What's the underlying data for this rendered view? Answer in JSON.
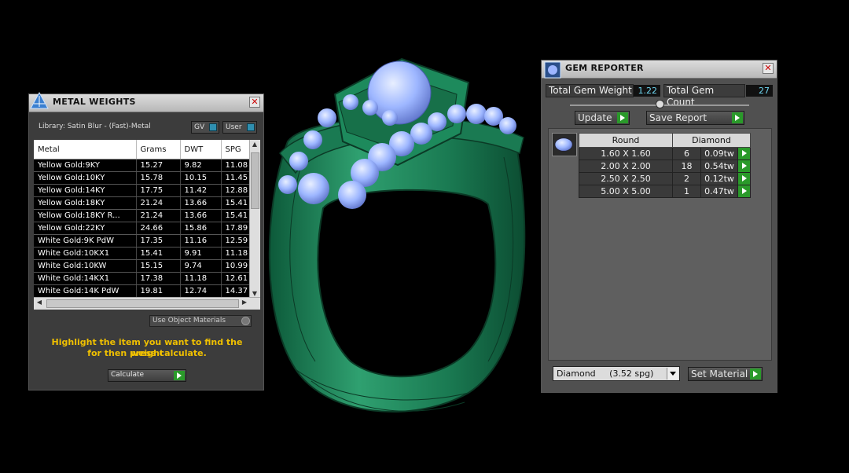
{
  "metal_weights": {
    "title": "METAL WEIGHTS",
    "library_label": "Library: Satin Blur - (Fast)-Metal",
    "toggle_gv": "GV",
    "toggle_user": "User",
    "columns": [
      "Metal",
      "Grams",
      "DWT",
      "SPG"
    ],
    "rows": [
      [
        "Yellow Gold:9KY",
        "15.27",
        "9.82",
        "11.08"
      ],
      [
        "Yellow Gold:10KY",
        "15.78",
        "10.15",
        "11.45"
      ],
      [
        "Yellow Gold:14KY",
        "17.75",
        "11.42",
        "12.88"
      ],
      [
        "Yellow Gold:18KY",
        "21.24",
        "13.66",
        "15.41"
      ],
      [
        "Yellow Gold:18KY R...",
        "21.24",
        "13.66",
        "15.41"
      ],
      [
        "Yellow Gold:22KY",
        "24.66",
        "15.86",
        "17.89"
      ],
      [
        "White Gold:9K PdW",
        "17.35",
        "11.16",
        "12.59"
      ],
      [
        "White Gold:10KX1",
        "15.41",
        "9.91",
        "11.18"
      ],
      [
        "White Gold:10KW",
        "15.15",
        "9.74",
        "10.99"
      ],
      [
        "White Gold:14KX1",
        "17.38",
        "11.18",
        "12.61"
      ],
      [
        "White Gold:14K PdW",
        "19.81",
        "12.74",
        "14.37"
      ]
    ],
    "use_object_materials": "Use Object Materials",
    "hint_line1": "Highlight the item you want to find the weight",
    "hint_line2": "for then press calculate.",
    "calculate_label": "Calculate"
  },
  "gem_reporter": {
    "title": "GEM REPORTER",
    "total_weight_label": "Total Gem Weight",
    "total_weight_value": "1.22",
    "total_count_label": "Total Gem Count",
    "total_count_value": "27",
    "update_label": "Update",
    "save_report_label": "Save Report",
    "shape_header": "Round",
    "material_header": "Diamond",
    "rows": [
      {
        "size": "1.60 X 1.60",
        "count": "6",
        "weight": "0.09tw"
      },
      {
        "size": "2.00 X 2.00",
        "count": "18",
        "weight": "0.54tw"
      },
      {
        "size": "2.50 X 2.50",
        "count": "2",
        "weight": "0.12tw"
      },
      {
        "size": "5.00 X 5.00",
        "count": "1",
        "weight": "0.47tw"
      }
    ],
    "material_select": "Diamond     (3.52 spg)",
    "set_material_label": "Set Material"
  },
  "colors": {
    "ring_green": "#1f8a5c",
    "gem_blue": "#9db6ff",
    "accent_green": "#2a9a2a",
    "hint_yellow": "#f0c000"
  }
}
